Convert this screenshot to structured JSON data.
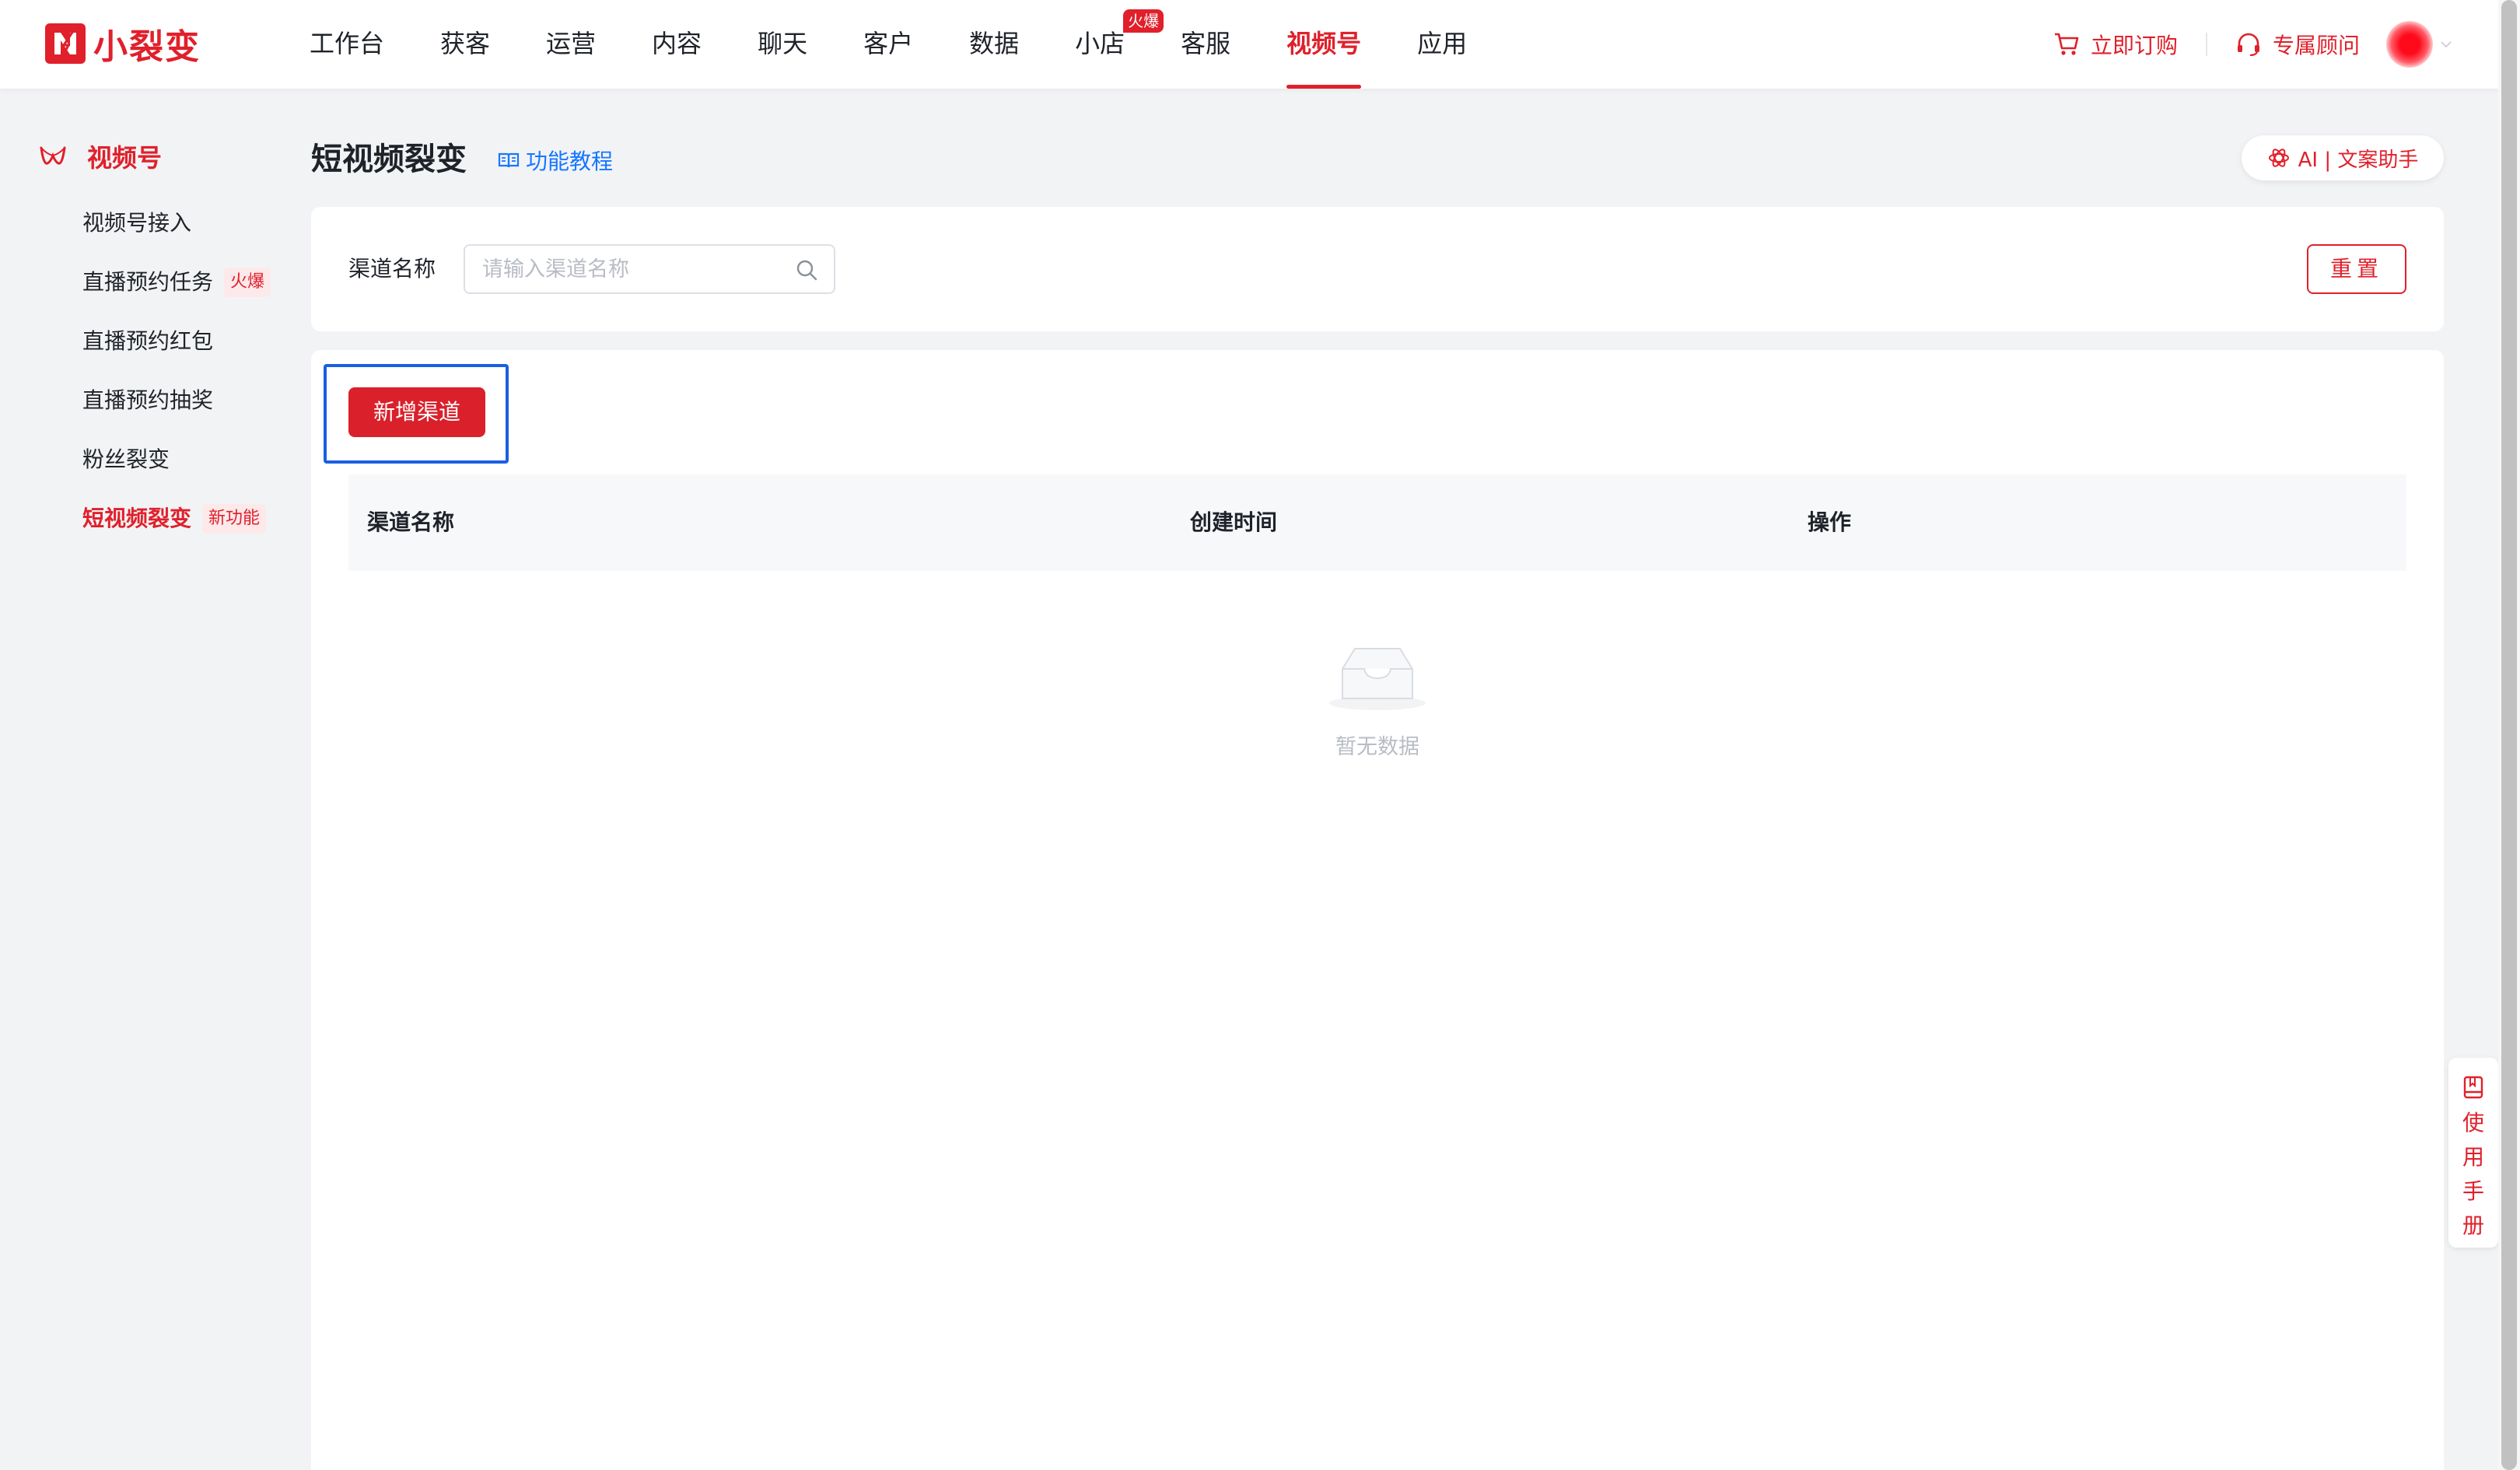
{
  "brand": {
    "name": "小裂变"
  },
  "nav": {
    "items": [
      {
        "label": "工作台"
      },
      {
        "label": "获客"
      },
      {
        "label": "运营"
      },
      {
        "label": "内容"
      },
      {
        "label": "聊天"
      },
      {
        "label": "客户"
      },
      {
        "label": "数据"
      },
      {
        "label": "小店",
        "badge": "火爆"
      },
      {
        "label": "客服"
      },
      {
        "label": "视频号"
      },
      {
        "label": "应用"
      }
    ],
    "active": "视频号"
  },
  "header_actions": {
    "subscribe": "立即订购",
    "advisor": "专属顾问"
  },
  "sidebar": {
    "title": "视频号",
    "items": [
      {
        "label": "视频号接入"
      },
      {
        "label": "直播预约任务",
        "badge": "火爆"
      },
      {
        "label": "直播预约红包"
      },
      {
        "label": "直播预约抽奖"
      },
      {
        "label": "粉丝裂变"
      },
      {
        "label": "短视频裂变",
        "badge": "新功能"
      }
    ],
    "active": "短视频裂变"
  },
  "page": {
    "title": "短视频裂变",
    "tutorial": "功能教程",
    "ai_assistant": "AI | 文案助手"
  },
  "filter": {
    "label": "渠道名称",
    "placeholder": "请输入渠道名称",
    "value": "",
    "reset": "重置"
  },
  "table": {
    "add_button": "新增渠道",
    "columns": [
      "渠道名称",
      "创建时间",
      "操作"
    ],
    "rows": [],
    "empty_text": "暂无数据"
  },
  "manual": {
    "label": "使用手册"
  },
  "colors": {
    "brand_red": "#e0202b",
    "link_blue": "#1677ff",
    "highlight_blue": "#1a5fe0",
    "page_bg": "#f2f3f5"
  }
}
